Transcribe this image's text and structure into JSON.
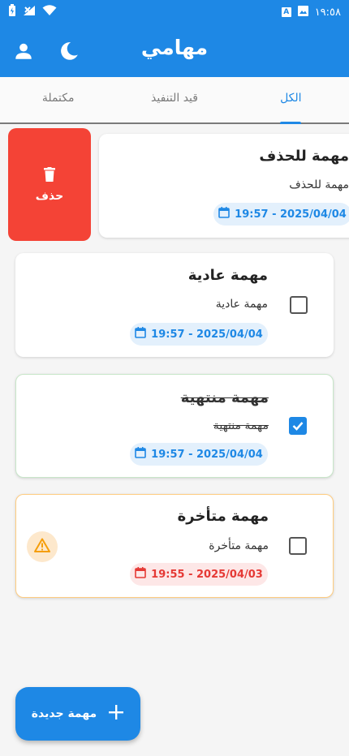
{
  "status_bar": {
    "time": "١٩:٥٨",
    "a_badge": "A"
  },
  "app_bar": {
    "title": "مهامي"
  },
  "tabs": [
    {
      "label": "مكتملة"
    },
    {
      "label": "قيد التنفيذ"
    },
    {
      "label": "الكل"
    }
  ],
  "swipe_action": {
    "label": "حذف"
  },
  "tasks": [
    {
      "title": "مهمة للحذف",
      "description": "مهمة للحذف",
      "date": "19:57 - 2025/04/04",
      "checked": false
    },
    {
      "title": "مهمة عادية",
      "description": "مهمة عادية",
      "date": "19:57 - 2025/04/04",
      "checked": false
    },
    {
      "title": "مهمة منتهية",
      "description": "مهمة منتهية",
      "date": "19:57 - 2025/04/04",
      "checked": true
    },
    {
      "title": "مهمة متأخرة",
      "description": "مهمة متأخرة",
      "date": "19:55 - 2025/04/03",
      "checked": false
    }
  ],
  "fab": {
    "label": "مهمة جديدة"
  },
  "colors": {
    "primary": "#1e88e5",
    "danger": "#f44336",
    "done_border": "#c8e6c9",
    "overdue_border": "#ffcc80",
    "overdue_date": "#e53935"
  }
}
